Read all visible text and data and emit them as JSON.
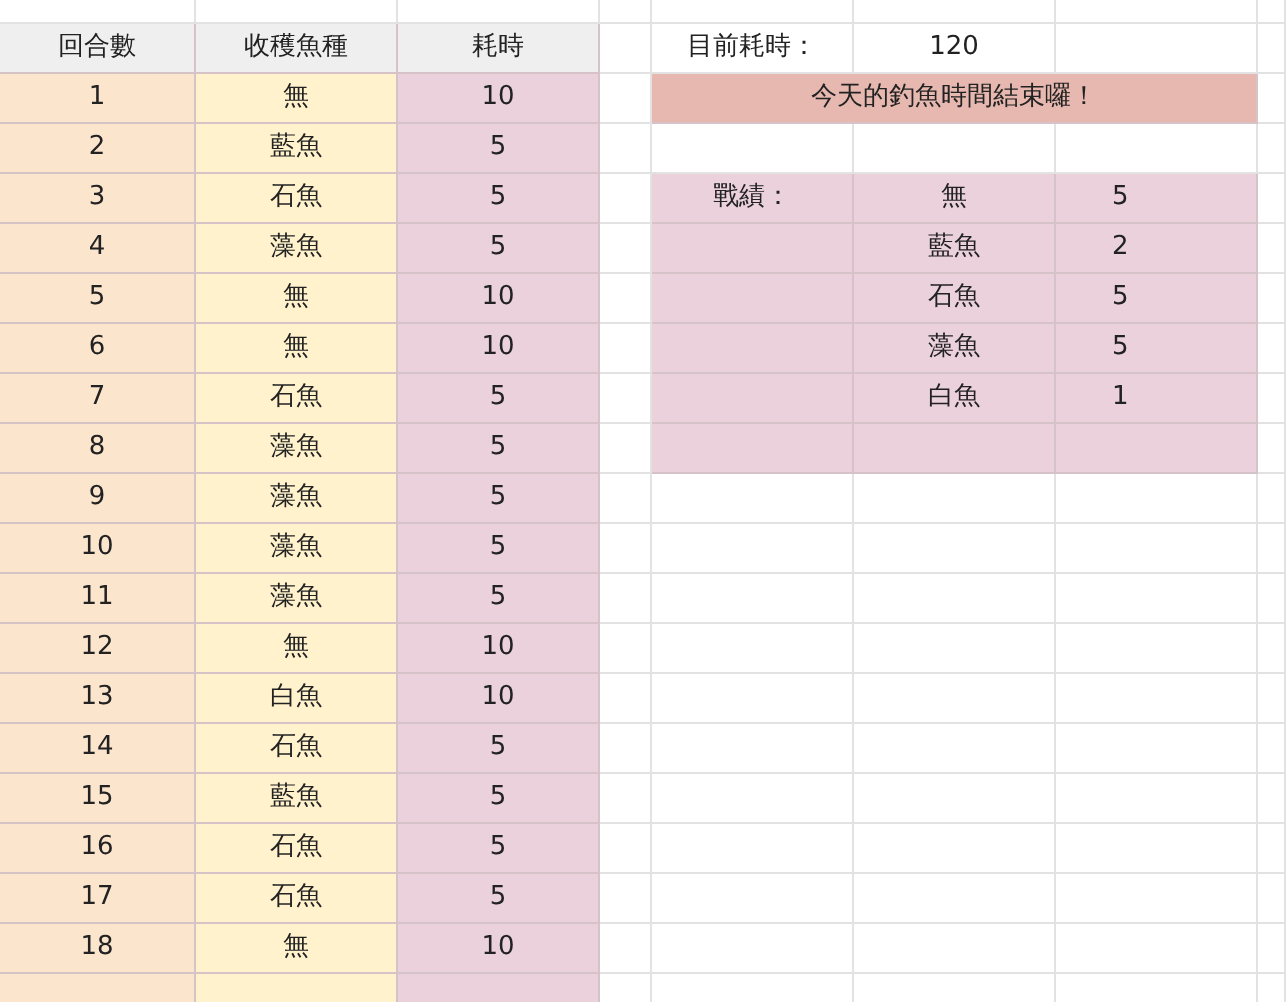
{
  "columns": [
    "回合數",
    "收穫魚種",
    "耗時"
  ],
  "rows": [
    {
      "round": "1",
      "catch": "無",
      "time": "10"
    },
    {
      "round": "2",
      "catch": "藍魚",
      "time": "5"
    },
    {
      "round": "3",
      "catch": "石魚",
      "time": "5"
    },
    {
      "round": "4",
      "catch": "藻魚",
      "time": "5"
    },
    {
      "round": "5",
      "catch": "無",
      "time": "10"
    },
    {
      "round": "6",
      "catch": "無",
      "time": "10"
    },
    {
      "round": "7",
      "catch": "石魚",
      "time": "5"
    },
    {
      "round": "8",
      "catch": "藻魚",
      "time": "5"
    },
    {
      "round": "9",
      "catch": "藻魚",
      "time": "5"
    },
    {
      "round": "10",
      "catch": "藻魚",
      "time": "5"
    },
    {
      "round": "11",
      "catch": "藻魚",
      "time": "5"
    },
    {
      "round": "12",
      "catch": "無",
      "time": "10"
    },
    {
      "round": "13",
      "catch": "白魚",
      "time": "10"
    },
    {
      "round": "14",
      "catch": "石魚",
      "time": "5"
    },
    {
      "round": "15",
      "catch": "藍魚",
      "time": "5"
    },
    {
      "round": "16",
      "catch": "石魚",
      "time": "5"
    },
    {
      "round": "17",
      "catch": "石魚",
      "time": "5"
    },
    {
      "round": "18",
      "catch": "無",
      "time": "10"
    }
  ],
  "current_time": {
    "label": "目前耗時：",
    "value": "120"
  },
  "banner": "今天的釣魚時間結束囉！",
  "results": {
    "label": "戰績：",
    "items": [
      {
        "fish": "無",
        "count": "5"
      },
      {
        "fish": "藍魚",
        "count": "2"
      },
      {
        "fish": "石魚",
        "count": "5"
      },
      {
        "fish": "藻魚",
        "count": "5"
      },
      {
        "fish": "白魚",
        "count": "1"
      }
    ]
  }
}
